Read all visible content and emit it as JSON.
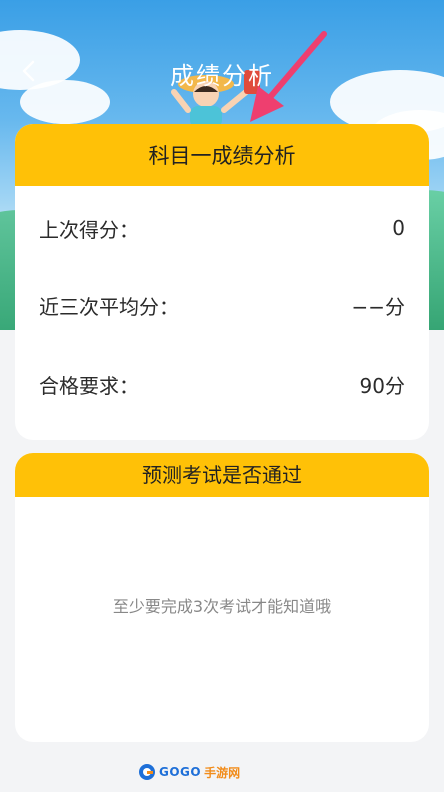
{
  "header": {
    "title": "成绩分析",
    "back_icon": "back-chevron-icon"
  },
  "colors": {
    "accent": "#ffc107",
    "hero_top": "#3a9fe6",
    "pointer_arrow": "#ee3f6f"
  },
  "score_card": {
    "title": "科目一成绩分析",
    "rows": [
      {
        "label": "上次得分：",
        "value": "0"
      },
      {
        "label": "近三次平均分：",
        "value": "−−分"
      },
      {
        "label": "合格要求：",
        "value": "90分"
      }
    ]
  },
  "prediction_card": {
    "title": "预测考试是否通过",
    "message": "至少要完成3次考试才能知道哦"
  },
  "watermark": {
    "brand": "GOGO",
    "brand_suffix": "手游网"
  }
}
